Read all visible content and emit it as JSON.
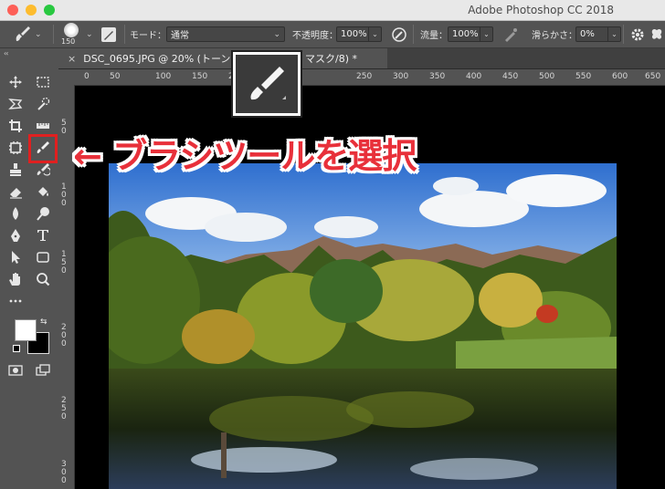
{
  "window": {
    "title": "Adobe Photoshop CC 2018"
  },
  "options_bar": {
    "brush_size": "150",
    "mode_label": "モード：",
    "mode_value": "通常",
    "opacity_label": "不透明度：",
    "opacity_value": "100%",
    "flow_label": "流量：",
    "flow_value": "100%",
    "smoothing_label": "滑らかさ：",
    "smoothing_value": "0%"
  },
  "document_tab": {
    "close": "×",
    "title": "DSC_0695.JPG @ 20% (トーン",
    "title_suffix": "マスク/8) *"
  },
  "rulers": {
    "horizontal": [
      "0",
      "50",
      "100",
      "150",
      "200",
      "250",
      "300",
      "350",
      "400",
      "450",
      "500",
      "550",
      "600",
      "650"
    ],
    "vertical": [
      "50",
      "100",
      "150",
      "200",
      "250",
      "300"
    ]
  },
  "annotation": {
    "text": "← ブラシツールを選択",
    "color": "#e8303a"
  },
  "icons": [
    "brush-icon",
    "gear-icon",
    "move-icon",
    "marquee-icon",
    "lasso-icon",
    "quick-select-icon",
    "crop-icon",
    "ruler-icon",
    "frame-icon",
    "brush-tool-icon",
    "stamp-icon",
    "history-brush-icon",
    "eraser-icon",
    "bucket-icon",
    "blur-icon",
    "dodge-icon",
    "pen-icon",
    "text-icon",
    "path-select-icon",
    "shape-icon",
    "hand-icon",
    "zoom-icon",
    "more-icon",
    "color-swatch-icon",
    "quick-mask-icon",
    "screen-mode-icon"
  ]
}
